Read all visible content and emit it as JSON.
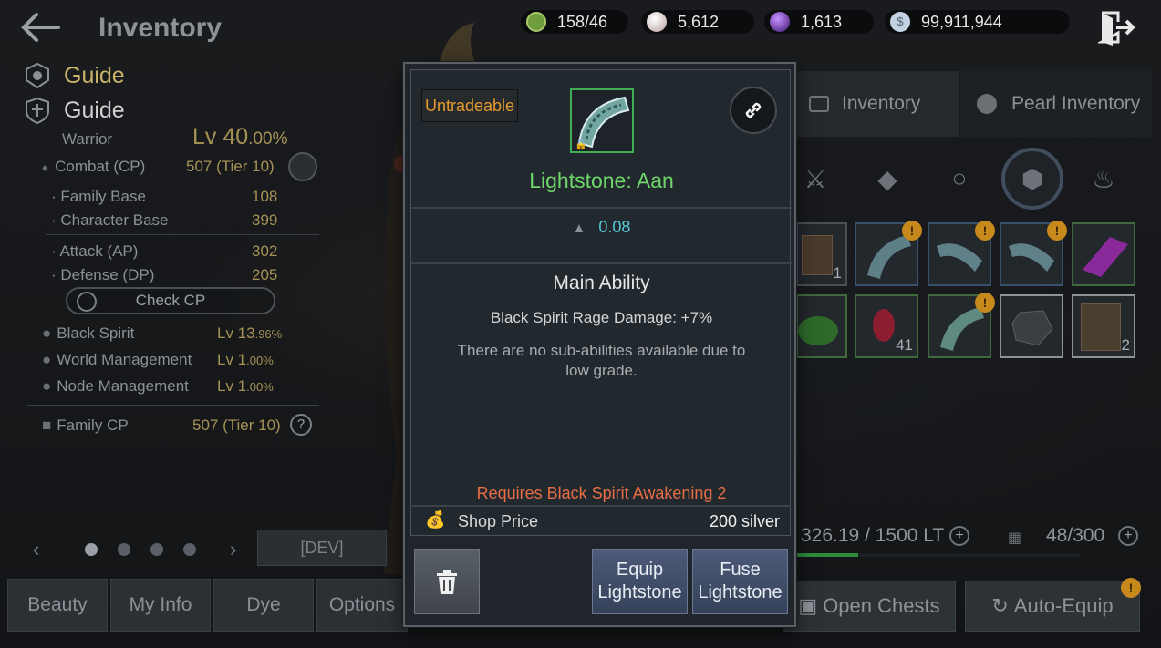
{
  "header": {
    "title": "Inventory",
    "currencies": [
      {
        "icon": "energy-icon",
        "value": "158/46",
        "color": "#7bb04a"
      },
      {
        "icon": "pearl-icon",
        "value": "5,612",
        "color": "#d9c6c6"
      },
      {
        "icon": "purple-orb-icon",
        "value": "1,613",
        "color": "#7a3fbf"
      },
      {
        "icon": "silver-coin-icon",
        "value": "99,911,944",
        "color": "#9fb6cf"
      }
    ]
  },
  "left": {
    "guide1": "Guide",
    "guide2": "Guide",
    "class_name": "Warrior",
    "level": "Lv 40",
    "level_pct": ".00%",
    "combat_label": "Combat (CP)",
    "combat_value": "507 (Tier 10)",
    "family_base_label": "Family Base",
    "family_base_value": "108",
    "char_base_label": "Character Base",
    "char_base_value": "399",
    "attack_label": "Attack (AP)",
    "attack_value": "302",
    "defense_label": "Defense (DP)",
    "defense_value": "205",
    "check_cp": "Check CP",
    "black_spirit_label": "Black Spirit",
    "black_spirit_level": "Lv 13",
    "black_spirit_pct": ".96%",
    "world_mgmt_label": "World Management",
    "world_mgmt_level": "Lv 1",
    "world_mgmt_pct": ".00%",
    "node_mgmt_label": "Node Management",
    "node_mgmt_level": "Lv 1",
    "node_mgmt_pct": ".00%",
    "family_cp_label": "Family CP",
    "family_cp_value": "507 (Tier 10)",
    "dev_button": "[DEV]"
  },
  "bottom_tabs": [
    "Beauty",
    "My Info",
    "Dye",
    "Options"
  ],
  "right": {
    "tab_inventory": "Inventory",
    "tab_pearl": "Pearl Inventory",
    "weight": "326.19 / 1500 LT",
    "weight_fill": 0.217,
    "slots": "48/300",
    "open_chests": "Open Chests",
    "auto_equip": "Auto-Equip",
    "slot_counts": {
      "book": "1",
      "red_gem": "41",
      "book2": "2"
    }
  },
  "tooltip": {
    "tradeability": "Untradeable",
    "item_name": "Lightstone: Aan",
    "weight": "0.08",
    "main_ability_title": "Main Ability",
    "main_ability": "Black Spirit Rage Damage: +7%",
    "sub_ability_note": "There are no sub-abilities available due to low grade.",
    "requirement": "Requires Black Spirit Awakening 2",
    "shop_price_label": "Shop Price",
    "shop_price_value": "200 silver",
    "equip_button": "Equip Lightstone",
    "fuse_button": "Fuse Lightstone",
    "name_color": "#6fd66c",
    "requirement_color": "#e66d45"
  }
}
